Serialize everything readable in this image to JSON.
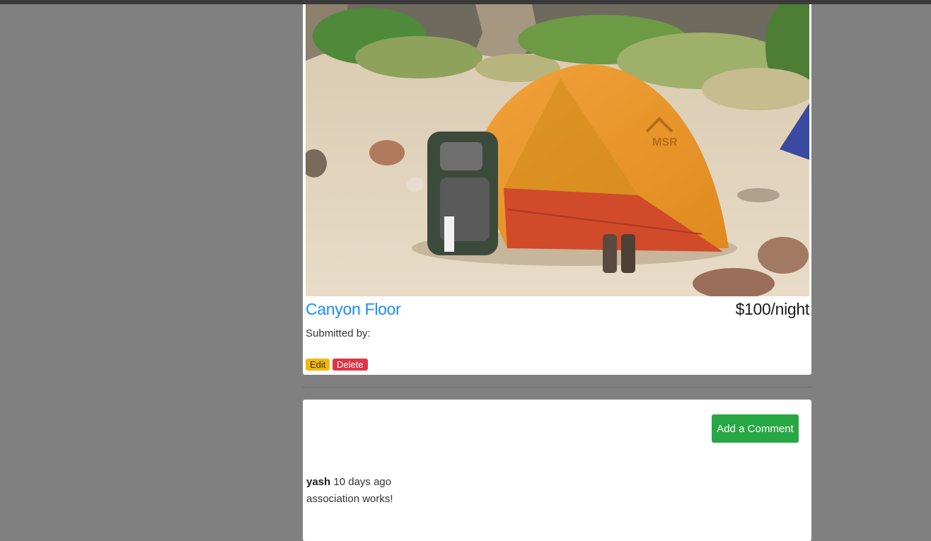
{
  "campground": {
    "image_alt": "Orange MSR tent with backpack on sandy canyon floor",
    "tent_logo": "MSR",
    "name": "Canyon Floor",
    "price": "$100/night",
    "submitted_by": "Submitted by:",
    "edit_label": "Edit",
    "delete_label": "Delete"
  },
  "comments": {
    "add_label": "Add a Comment",
    "items": [
      {
        "author": "yash",
        "time": "10 days ago",
        "text": "association works!"
      }
    ]
  },
  "colors": {
    "page_bg": "#808080",
    "link_blue": "#1a8cff",
    "edit_yellow": "#f5b800",
    "delete_red": "#dc3545",
    "add_green": "#28a745"
  }
}
